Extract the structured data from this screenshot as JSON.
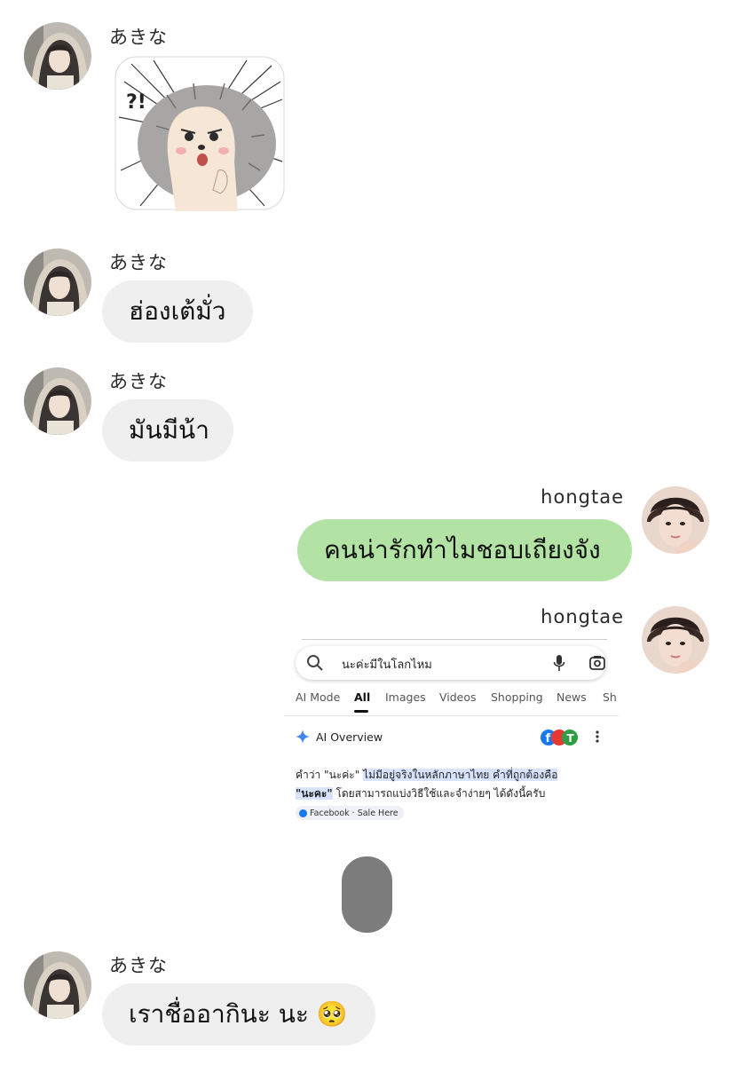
{
  "messages": {
    "m1": {
      "sender": "あきな",
      "type": "sticker",
      "sticker": {
        "text": "?!"
      }
    },
    "m2": {
      "sender": "あきな",
      "text": "ฮ่องเต้มั่ว"
    },
    "m3": {
      "sender": "あきな",
      "text": "มันมีน้า"
    },
    "m4": {
      "sender": "hongtae",
      "text": "คนน่ารักทำไมชอบเถียงจัง"
    },
    "m5": {
      "sender": "hongtae",
      "type": "image",
      "screenshot": {
        "query": "นะค่ะมีในโลกไหม",
        "tabs": [
          "AI Mode",
          "All",
          "Images",
          "Videos",
          "Shopping",
          "News",
          "Sh"
        ],
        "active_tab": "All",
        "overview_label": "AI Overview",
        "overview": {
          "line1_plain": "คำว่า \"นะค่ะ\" ",
          "line1_highlight": "ไม่มีอยู่จริงในหลักภาษาไทย คำที่ถูกต้องคือ",
          "line2_highlight": "\"นะคะ\"",
          "line2_plain": " โดยสามารถแบ่งวิธีใช้และจำง่ายๆ ได้ดังนี้ครับ"
        },
        "source_chip": "Facebook · Sale Here"
      }
    },
    "m6": {
      "sender": "あきな",
      "text": "เราชื่ออากินะ นะ 🥺"
    }
  },
  "colors": {
    "incoming_bubble": "#efefef",
    "outgoing_bubble": "#b2e3a5",
    "background": "#ffffff",
    "scroll_thumb": "#7c7c7c",
    "google_blue": "#4285f4"
  }
}
